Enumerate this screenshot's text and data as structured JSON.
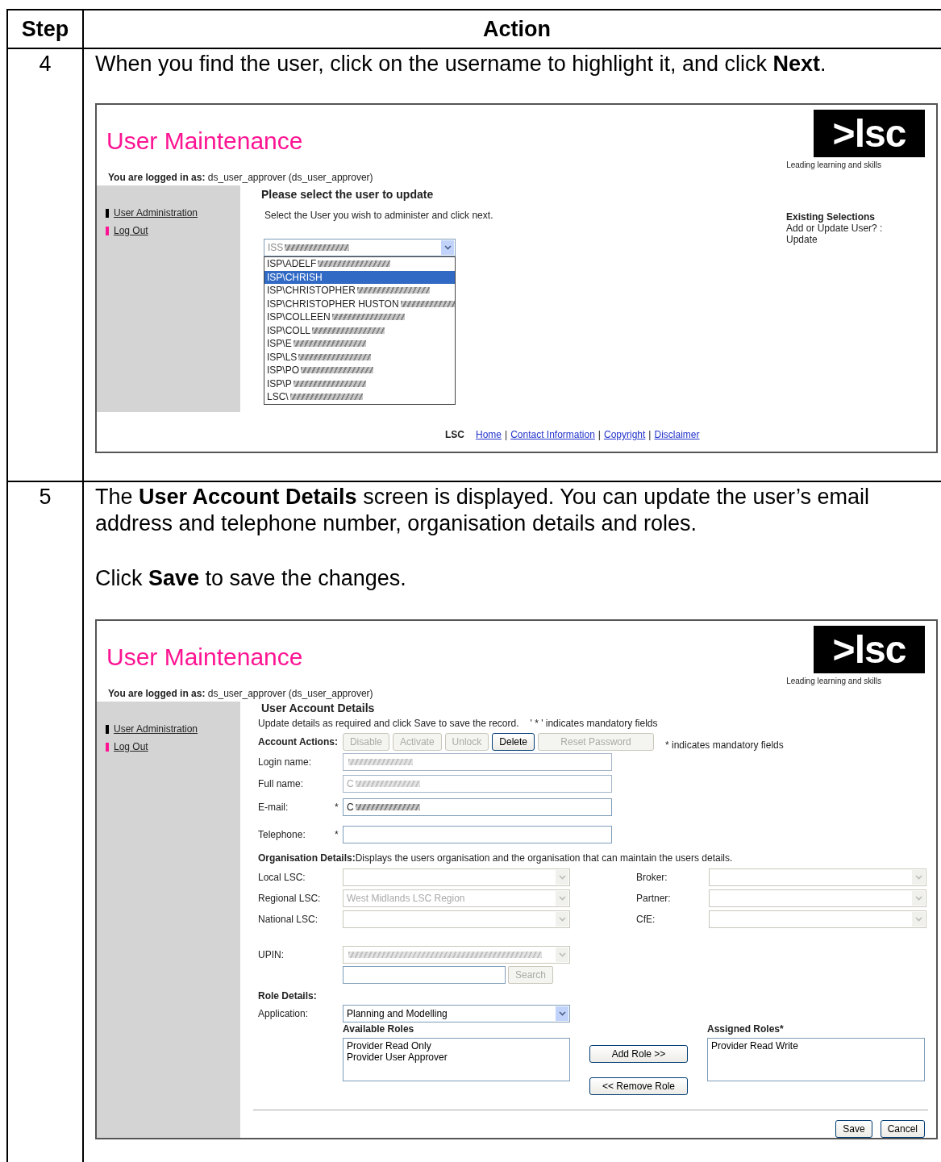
{
  "table": {
    "columns": [
      "Step",
      "Action"
    ],
    "rows": [
      {
        "kind": "select_user",
        "step": "4",
        "paragraphs": [
          "When you find the user, click on the username to highlight it, and click **Next**."
        ],
        "screen": {
          "title": "User Maintenance",
          "logo_text": ">lsc",
          "tagline": "Leading learning and skills",
          "logged_in_label": "You are logged in as:",
          "logged_in_value": "ds_user_approver (ds_user_approver)",
          "sidebar_links": [
            {
              "label": "User Administration",
              "color": "#000000"
            },
            {
              "label": "Log Out",
              "color": "#ff1493"
            }
          ],
          "heading": "Please select the user to update",
          "hint": "Select the User you wish to administer and click next.",
          "user_dropdown": {
            "value": "ISS",
            "redacted": true,
            "expanded": true,
            "options": [
              {
                "label": "ISP\\ADELF",
                "redacted": true,
                "selected": false
              },
              {
                "label": "ISP\\CHRISH",
                "redacted": false,
                "selected": true
              },
              {
                "label": "ISP\\CHRISTOPHER",
                "redacted": true,
                "selected": false
              },
              {
                "label": "ISP\\CHRISTOPHER HUSTON",
                "redacted": true,
                "selected": false
              },
              {
                "label": "ISP\\COLLEEN",
                "redacted": true,
                "selected": false
              },
              {
                "label": "ISP\\COLL",
                "redacted": true,
                "selected": false
              },
              {
                "label": "ISP\\E",
                "redacted": true,
                "selected": false
              },
              {
                "label": "ISP\\LS",
                "redacted": true,
                "selected": false
              },
              {
                "label": "ISP\\PO",
                "redacted": true,
                "selected": false
              },
              {
                "label": "ISP\\P",
                "redacted": true,
                "selected": false
              },
              {
                "label": "LSC\\",
                "redacted": true,
                "selected": false
              }
            ]
          },
          "existing": {
            "title": "Existing Selections",
            "question": "Add or Update User? :",
            "answer": "Update"
          },
          "footer": {
            "org": "LSC",
            "separator": "|",
            "links": [
              "Home",
              "Contact Information",
              "Copyright",
              "Disclaimer"
            ]
          }
        }
      },
      {
        "kind": "account_details",
        "step": "5",
        "paragraphs": [
          "The **User Account Details** screen is displayed.  You can update the user’s email address and telephone number, organisation details and roles.",
          "Click **Save** to save the changes."
        ],
        "screen": {
          "title": "User Maintenance",
          "logo_text": ">lsc",
          "tagline": "Leading learning and skills",
          "logged_in_label": "You are logged in as:",
          "logged_in_value": "ds_user_approver (ds_user_approver)",
          "sidebar_links": [
            {
              "label": "User Administration",
              "color": "#000000"
            },
            {
              "label": "Log Out",
              "color": "#ff1493"
            }
          ],
          "heading": "User Account Details",
          "intro": "Update details as required and click Save to save the record.",
          "intro_note": "' * ' indicates mandatory fields",
          "account_actions_label": "Account Actions:",
          "account_actions": [
            {
              "label": "Disable",
              "disabled": true
            },
            {
              "label": "Activate",
              "disabled": true
            },
            {
              "label": "Unlock",
              "disabled": true
            },
            {
              "label": "Delete",
              "disabled": false
            },
            {
              "label": "Reset Password",
              "disabled": true
            }
          ],
          "mandatory_note": "* indicates mandatory fields",
          "fields": [
            {
              "label": "Login name:",
              "disabled": true,
              "redacted": true
            },
            {
              "label": "Full name:",
              "disabled": true,
              "value": "C",
              "redacted": true
            },
            {
              "label": "E-mail:",
              "required_mark": "*",
              "disabled": false,
              "value": "C",
              "redacted": true
            },
            {
              "label": "Telephone:",
              "required_mark": "*",
              "disabled": false
            }
          ],
          "org_label": "Organisation Details:",
          "org_text": "Displays the users organisation and the organisation that can maintain the users details.",
          "org_fields": [
            {
              "label": "Local LSC:"
            },
            {
              "label": "Broker:"
            },
            {
              "label": "Regional LSC:",
              "value": "West Midlands LSC Region"
            },
            {
              "label": "Partner:"
            },
            {
              "label": "National LSC:"
            },
            {
              "label": "CfE:"
            }
          ],
          "upin_label": "UPIN:",
          "upin_redacted": true,
          "search_button": {
            "label": "Search",
            "disabled": true
          },
          "role_label": "Role Details:",
          "application_label": "Application:",
          "application_value": "Planning and Modelling",
          "available_label": "Available Roles",
          "available_roles": [
            "Provider Read Only",
            "Provider User Approver"
          ],
          "add_button": "Add Role >>",
          "remove_button": "<< Remove Role",
          "assigned_label": "Assigned Roles*",
          "assigned_roles": [
            "Provider Read Write"
          ],
          "save_button": "Save",
          "cancel_button": "Cancel"
        }
      }
    ]
  }
}
